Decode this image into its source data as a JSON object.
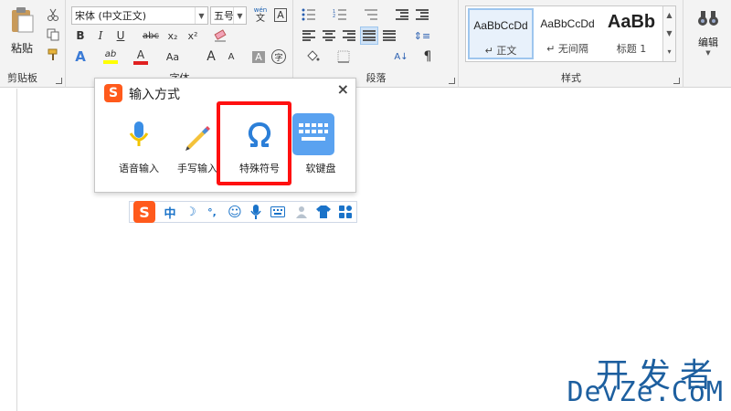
{
  "ribbon": {
    "clipboard": {
      "paste_label": "粘贴",
      "group_label": "剪贴板"
    },
    "font": {
      "font_name": "宋体 (中文正文)",
      "font_size": "五号",
      "wen_label": "wén",
      "wen_sub": "文",
      "box_a": "A",
      "bold": "B",
      "italic": "I",
      "underline": "U",
      "strike": "abc",
      "subscript": "x₂",
      "superscript": "x²",
      "effects": "A",
      "highlight": "ab",
      "font_color": "A",
      "aa": "Aa",
      "grow": "A",
      "shrink": "A",
      "shade": "A",
      "circle": "字",
      "group_label": "字体"
    },
    "paragraph": {
      "group_label": "段落",
      "sort": "A↓",
      "pilcrow": "¶"
    },
    "styles": {
      "group_label": "样式",
      "items": [
        {
          "sample": "AaBbCcDd",
          "name": "↵ 正文"
        },
        {
          "sample": "AaBbCcDd",
          "name": "↵ 无间隔"
        },
        {
          "sample": "AaBb",
          "name": "标题 1"
        }
      ]
    },
    "editing": {
      "label": "编辑"
    }
  },
  "popup": {
    "title": "输入方式",
    "close": "×",
    "logo": "S",
    "items": [
      {
        "label": "语音输入",
        "icon": "microphone-icon"
      },
      {
        "label": "手写输入",
        "icon": "pencil-icon"
      },
      {
        "label": "特殊符号",
        "icon": "omega-icon"
      },
      {
        "label": "软键盘",
        "icon": "keyboard-icon"
      }
    ]
  },
  "ime_bar": {
    "logo": "S",
    "mode": "中",
    "moon": "☽",
    "punct": "°,",
    "emoji": "☺",
    "icons": [
      "microphone-icon",
      "keyboard-icon",
      "user-icon",
      "shirt-icon",
      "grid-icon"
    ]
  },
  "watermark": {
    "line1": "开发者",
    "line2": "DevZe.CoM"
  },
  "colors": {
    "accent": "#1a73c9",
    "highlight_border": "#ff1010",
    "sogou_orange": "#ff5a1c",
    "watermark": "#1d5f9f"
  }
}
